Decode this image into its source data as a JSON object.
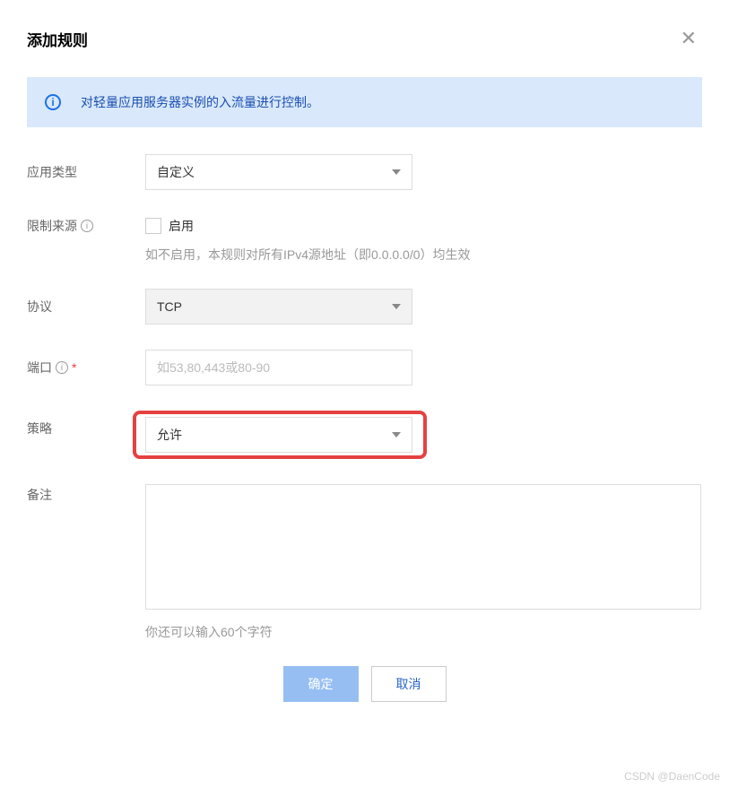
{
  "modal": {
    "title": "添加规则",
    "info_banner": "对轻量应用服务器实例的入流量进行控制。"
  },
  "form": {
    "app_type": {
      "label": "应用类型",
      "value": "自定义"
    },
    "restrict_source": {
      "label": "限制来源",
      "enable_label": "启用",
      "helper": "如不启用，本规则对所有IPv4源地址（即0.0.0.0/0）均生效"
    },
    "protocol": {
      "label": "协议",
      "value": "TCP"
    },
    "port": {
      "label": "端口",
      "placeholder": "如53,80,443或80-90"
    },
    "policy": {
      "label": "策略",
      "value": "允许"
    },
    "remark": {
      "label": "备注",
      "helper": "你还可以输入60个字符"
    }
  },
  "buttons": {
    "ok": "确定",
    "cancel": "取消"
  },
  "watermark": "CSDN @DaenCode"
}
